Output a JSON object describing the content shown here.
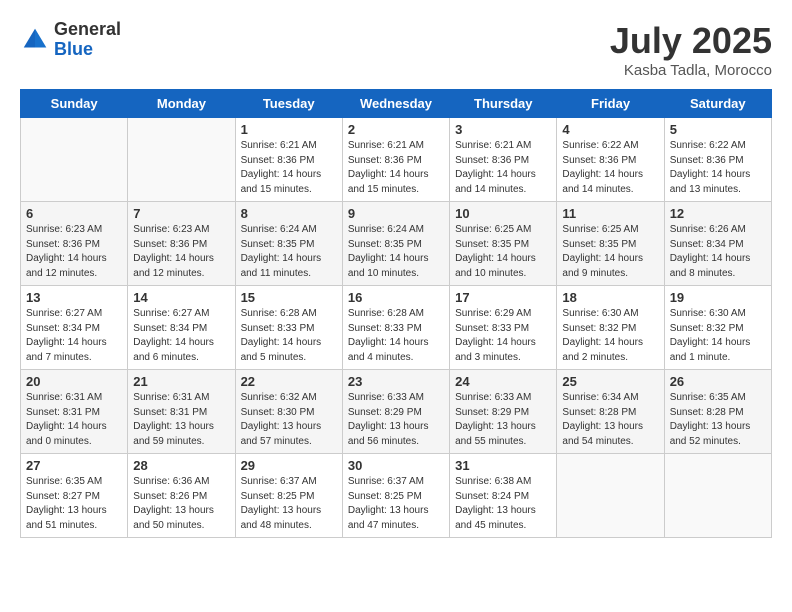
{
  "header": {
    "logo_general": "General",
    "logo_blue": "Blue",
    "month": "July 2025",
    "location": "Kasba Tadla, Morocco"
  },
  "days_of_week": [
    "Sunday",
    "Monday",
    "Tuesday",
    "Wednesday",
    "Thursday",
    "Friday",
    "Saturday"
  ],
  "weeks": [
    [
      {
        "day": "",
        "sunrise": "",
        "sunset": "",
        "daylight": ""
      },
      {
        "day": "",
        "sunrise": "",
        "sunset": "",
        "daylight": ""
      },
      {
        "day": "1",
        "sunrise": "Sunrise: 6:21 AM",
        "sunset": "Sunset: 8:36 PM",
        "daylight": "Daylight: 14 hours and 15 minutes."
      },
      {
        "day": "2",
        "sunrise": "Sunrise: 6:21 AM",
        "sunset": "Sunset: 8:36 PM",
        "daylight": "Daylight: 14 hours and 15 minutes."
      },
      {
        "day": "3",
        "sunrise": "Sunrise: 6:21 AM",
        "sunset": "Sunset: 8:36 PM",
        "daylight": "Daylight: 14 hours and 14 minutes."
      },
      {
        "day": "4",
        "sunrise": "Sunrise: 6:22 AM",
        "sunset": "Sunset: 8:36 PM",
        "daylight": "Daylight: 14 hours and 14 minutes."
      },
      {
        "day": "5",
        "sunrise": "Sunrise: 6:22 AM",
        "sunset": "Sunset: 8:36 PM",
        "daylight": "Daylight: 14 hours and 13 minutes."
      }
    ],
    [
      {
        "day": "6",
        "sunrise": "Sunrise: 6:23 AM",
        "sunset": "Sunset: 8:36 PM",
        "daylight": "Daylight: 14 hours and 12 minutes."
      },
      {
        "day": "7",
        "sunrise": "Sunrise: 6:23 AM",
        "sunset": "Sunset: 8:36 PM",
        "daylight": "Daylight: 14 hours and 12 minutes."
      },
      {
        "day": "8",
        "sunrise": "Sunrise: 6:24 AM",
        "sunset": "Sunset: 8:35 PM",
        "daylight": "Daylight: 14 hours and 11 minutes."
      },
      {
        "day": "9",
        "sunrise": "Sunrise: 6:24 AM",
        "sunset": "Sunset: 8:35 PM",
        "daylight": "Daylight: 14 hours and 10 minutes."
      },
      {
        "day": "10",
        "sunrise": "Sunrise: 6:25 AM",
        "sunset": "Sunset: 8:35 PM",
        "daylight": "Daylight: 14 hours and 10 minutes."
      },
      {
        "day": "11",
        "sunrise": "Sunrise: 6:25 AM",
        "sunset": "Sunset: 8:35 PM",
        "daylight": "Daylight: 14 hours and 9 minutes."
      },
      {
        "day": "12",
        "sunrise": "Sunrise: 6:26 AM",
        "sunset": "Sunset: 8:34 PM",
        "daylight": "Daylight: 14 hours and 8 minutes."
      }
    ],
    [
      {
        "day": "13",
        "sunrise": "Sunrise: 6:27 AM",
        "sunset": "Sunset: 8:34 PM",
        "daylight": "Daylight: 14 hours and 7 minutes."
      },
      {
        "day": "14",
        "sunrise": "Sunrise: 6:27 AM",
        "sunset": "Sunset: 8:34 PM",
        "daylight": "Daylight: 14 hours and 6 minutes."
      },
      {
        "day": "15",
        "sunrise": "Sunrise: 6:28 AM",
        "sunset": "Sunset: 8:33 PM",
        "daylight": "Daylight: 14 hours and 5 minutes."
      },
      {
        "day": "16",
        "sunrise": "Sunrise: 6:28 AM",
        "sunset": "Sunset: 8:33 PM",
        "daylight": "Daylight: 14 hours and 4 minutes."
      },
      {
        "day": "17",
        "sunrise": "Sunrise: 6:29 AM",
        "sunset": "Sunset: 8:33 PM",
        "daylight": "Daylight: 14 hours and 3 minutes."
      },
      {
        "day": "18",
        "sunrise": "Sunrise: 6:30 AM",
        "sunset": "Sunset: 8:32 PM",
        "daylight": "Daylight: 14 hours and 2 minutes."
      },
      {
        "day": "19",
        "sunrise": "Sunrise: 6:30 AM",
        "sunset": "Sunset: 8:32 PM",
        "daylight": "Daylight: 14 hours and 1 minute."
      }
    ],
    [
      {
        "day": "20",
        "sunrise": "Sunrise: 6:31 AM",
        "sunset": "Sunset: 8:31 PM",
        "daylight": "Daylight: 14 hours and 0 minutes."
      },
      {
        "day": "21",
        "sunrise": "Sunrise: 6:31 AM",
        "sunset": "Sunset: 8:31 PM",
        "daylight": "Daylight: 13 hours and 59 minutes."
      },
      {
        "day": "22",
        "sunrise": "Sunrise: 6:32 AM",
        "sunset": "Sunset: 8:30 PM",
        "daylight": "Daylight: 13 hours and 57 minutes."
      },
      {
        "day": "23",
        "sunrise": "Sunrise: 6:33 AM",
        "sunset": "Sunset: 8:29 PM",
        "daylight": "Daylight: 13 hours and 56 minutes."
      },
      {
        "day": "24",
        "sunrise": "Sunrise: 6:33 AM",
        "sunset": "Sunset: 8:29 PM",
        "daylight": "Daylight: 13 hours and 55 minutes."
      },
      {
        "day": "25",
        "sunrise": "Sunrise: 6:34 AM",
        "sunset": "Sunset: 8:28 PM",
        "daylight": "Daylight: 13 hours and 54 minutes."
      },
      {
        "day": "26",
        "sunrise": "Sunrise: 6:35 AM",
        "sunset": "Sunset: 8:28 PM",
        "daylight": "Daylight: 13 hours and 52 minutes."
      }
    ],
    [
      {
        "day": "27",
        "sunrise": "Sunrise: 6:35 AM",
        "sunset": "Sunset: 8:27 PM",
        "daylight": "Daylight: 13 hours and 51 minutes."
      },
      {
        "day": "28",
        "sunrise": "Sunrise: 6:36 AM",
        "sunset": "Sunset: 8:26 PM",
        "daylight": "Daylight: 13 hours and 50 minutes."
      },
      {
        "day": "29",
        "sunrise": "Sunrise: 6:37 AM",
        "sunset": "Sunset: 8:25 PM",
        "daylight": "Daylight: 13 hours and 48 minutes."
      },
      {
        "day": "30",
        "sunrise": "Sunrise: 6:37 AM",
        "sunset": "Sunset: 8:25 PM",
        "daylight": "Daylight: 13 hours and 47 minutes."
      },
      {
        "day": "31",
        "sunrise": "Sunrise: 6:38 AM",
        "sunset": "Sunset: 8:24 PM",
        "daylight": "Daylight: 13 hours and 45 minutes."
      },
      {
        "day": "",
        "sunrise": "",
        "sunset": "",
        "daylight": ""
      },
      {
        "day": "",
        "sunrise": "",
        "sunset": "",
        "daylight": ""
      }
    ]
  ]
}
